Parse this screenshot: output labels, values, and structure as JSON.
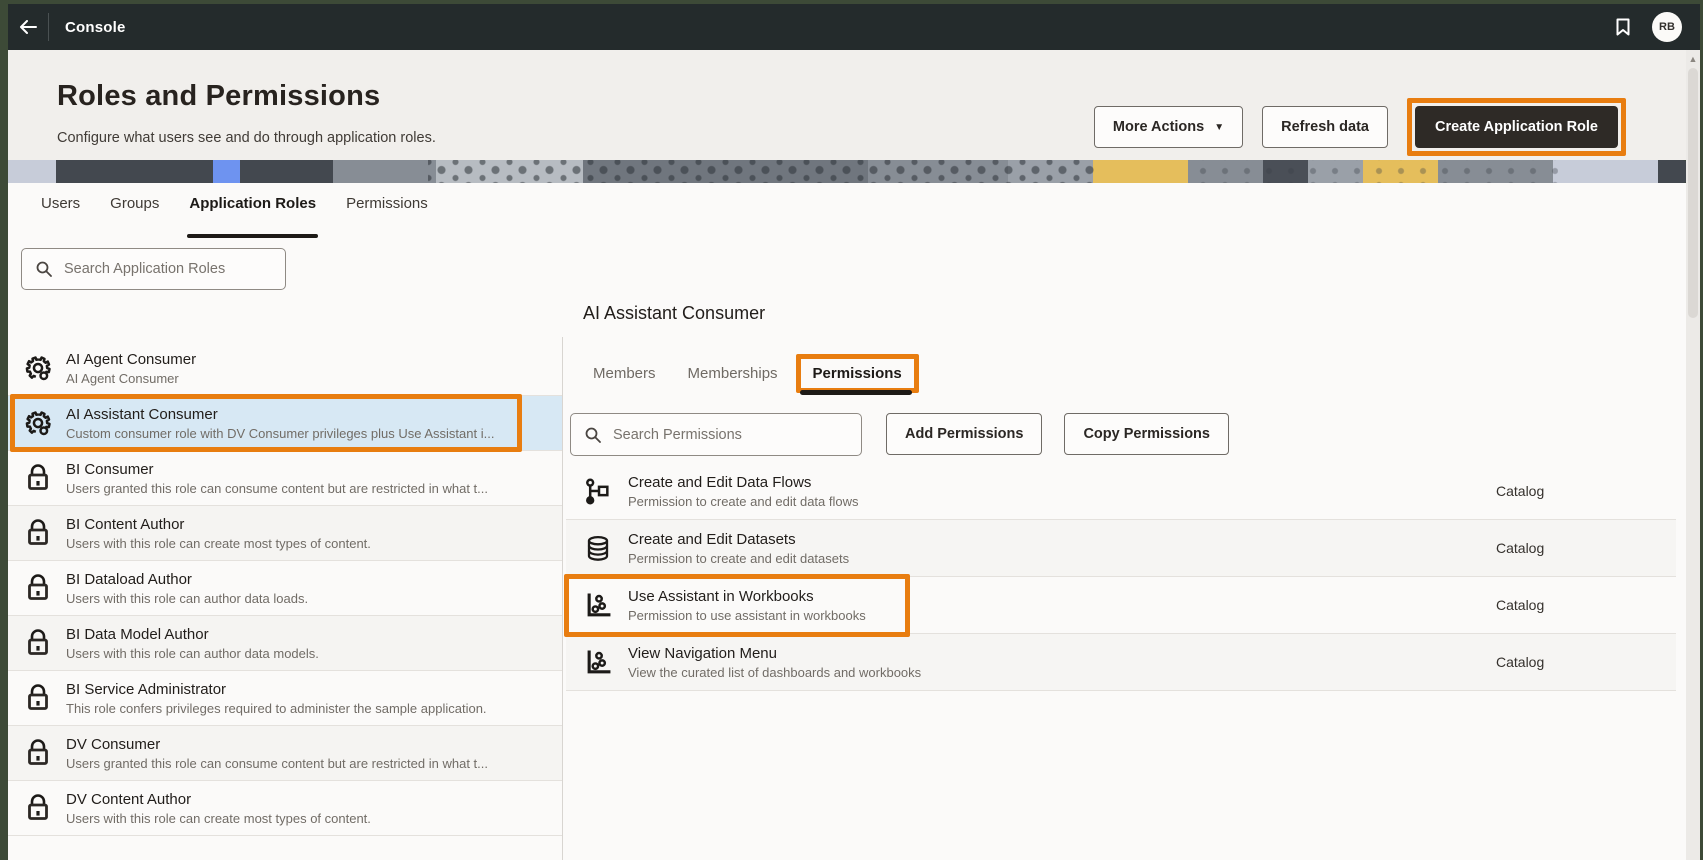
{
  "colors": {
    "annotation_orange": "#e87d10",
    "selection_blue": "#d7e8f4",
    "topbar_dark": "#242b2c",
    "primary_button_dark": "#2e2a26"
  },
  "topbar": {
    "title": "Console",
    "back_icon": "back-arrow-icon",
    "bookmark_icon": "bookmark-icon",
    "avatar_initials": "RB"
  },
  "header": {
    "title": "Roles and Permissions",
    "subtitle": "Configure what users see and do through application roles.",
    "more_actions_label": "More Actions",
    "refresh_label": "Refresh data",
    "create_label": "Create Application Role"
  },
  "main_tabs": [
    {
      "label": "Users",
      "active": false
    },
    {
      "label": "Groups",
      "active": false
    },
    {
      "label": "Application Roles",
      "active": true
    },
    {
      "label": "Permissions",
      "active": false
    }
  ],
  "role_search": {
    "placeholder": "Search Application Roles"
  },
  "roles": [
    {
      "name": "AI Agent Consumer",
      "desc": "AI Agent Consumer",
      "icon": "gear-icon",
      "selected": false,
      "striped": false,
      "highlighted": false
    },
    {
      "name": "AI Assistant Consumer",
      "desc": "Custom consumer role with DV Consumer privileges plus Use Assistant i...",
      "icon": "gear-icon",
      "selected": true,
      "striped": false,
      "highlighted": true
    },
    {
      "name": "BI Consumer",
      "desc": "Users granted this role can consume content but are restricted in what t...",
      "icon": "lock-icon",
      "selected": false,
      "striped": false,
      "highlighted": false
    },
    {
      "name": "BI Content Author",
      "desc": "Users with this role can create most types of content.",
      "icon": "lock-icon",
      "selected": false,
      "striped": true,
      "highlighted": false
    },
    {
      "name": "BI Dataload Author",
      "desc": "Users with this role can author data loads.",
      "icon": "lock-icon",
      "selected": false,
      "striped": false,
      "highlighted": false
    },
    {
      "name": "BI Data Model Author",
      "desc": "Users with this role can author data models.",
      "icon": "lock-icon",
      "selected": false,
      "striped": true,
      "highlighted": false
    },
    {
      "name": "BI Service Administrator",
      "desc": "This role confers privileges required to administer the sample application.",
      "icon": "lock-icon",
      "selected": false,
      "striped": false,
      "highlighted": false
    },
    {
      "name": "DV Consumer",
      "desc": "Users granted this role can consume content but are restricted in what t...",
      "icon": "lock-icon",
      "selected": false,
      "striped": true,
      "highlighted": false
    },
    {
      "name": "DV Content Author",
      "desc": "Users with this role can create most types of content.",
      "icon": "lock-icon",
      "selected": false,
      "striped": false,
      "highlighted": false
    }
  ],
  "detail": {
    "title": "AI Assistant Consumer",
    "tabs": [
      {
        "label": "Members",
        "active": false,
        "highlighted": false
      },
      {
        "label": "Memberships",
        "active": false,
        "highlighted": false
      },
      {
        "label": "Permissions",
        "active": true,
        "highlighted": true
      }
    ],
    "search_placeholder": "Search Permissions",
    "add_label": "Add Permissions",
    "copy_label": "Copy Permissions",
    "permissions": [
      {
        "name": "Create and Edit Data Flows",
        "desc": "Permission to create and edit data flows",
        "icon": "data-flow-icon",
        "scope": "Catalog",
        "striped": false,
        "highlighted": false
      },
      {
        "name": "Create and Edit Datasets",
        "desc": "Permission to create and edit datasets",
        "icon": "dataset-icon",
        "scope": "Catalog",
        "striped": true,
        "highlighted": false
      },
      {
        "name": "Use Assistant in Workbooks",
        "desc": "Permission to use assistant in workbooks",
        "icon": "scatter-chart-icon",
        "scope": "Catalog",
        "striped": false,
        "highlighted": true
      },
      {
        "name": "View Navigation Menu",
        "desc": "View the curated list of dashboards and workbooks",
        "icon": "scatter-chart-icon",
        "scope": "Catalog",
        "striped": true,
        "highlighted": false
      }
    ]
  }
}
